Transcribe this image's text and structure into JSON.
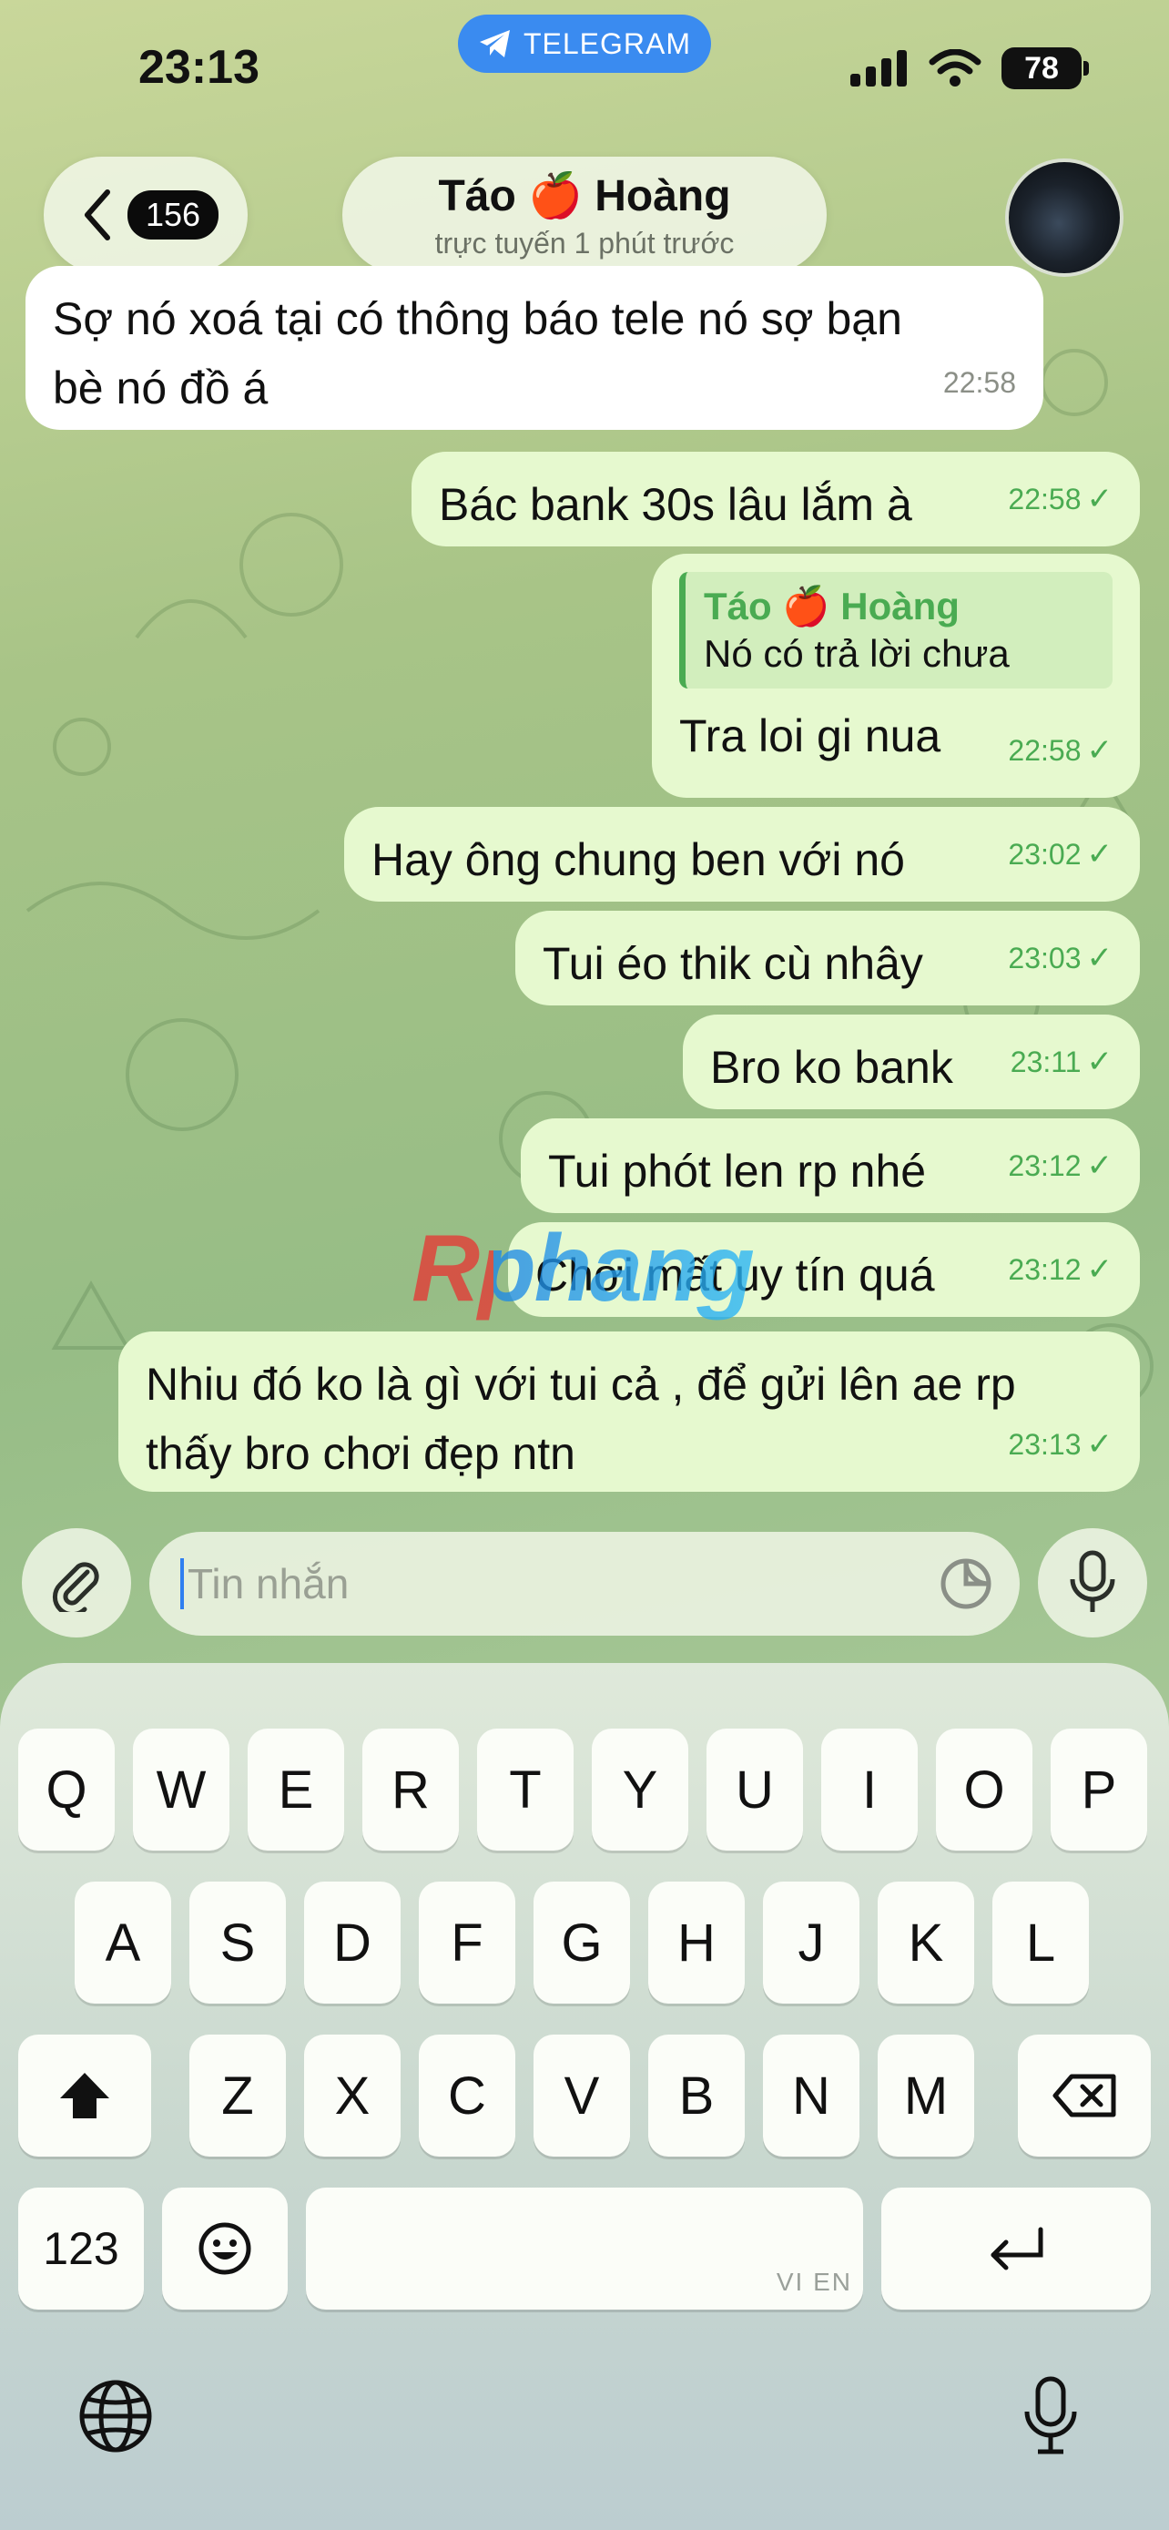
{
  "status_bar": {
    "time": "23:13",
    "app_pill": "TELEGRAM",
    "battery": "78"
  },
  "header": {
    "back_count": "156",
    "contact_name": "Táo 🍎 Hoàng",
    "contact_status": "trực tuyến 1 phút trước"
  },
  "messages": [
    {
      "direction": "in",
      "text_lines": [
        "Sợ nó xoá tại có thông báo tele nó sợ bạn",
        "bè nó đồ á"
      ],
      "time": "22:58"
    },
    {
      "direction": "out",
      "text": "Bác bank 30s lâu lắm à",
      "time": "22:58",
      "check": "✓"
    },
    {
      "direction": "out",
      "reply_name": "Táo 🍎 Hoàng",
      "reply_text": "Nó có trả lời chưa",
      "text": "Tra loi gi nua",
      "time": "22:58",
      "check": "✓"
    },
    {
      "direction": "out",
      "text": "Hay ông chung ben với nó",
      "time": "23:02",
      "check": "✓"
    },
    {
      "direction": "out",
      "text": "Tui éo thik cù nhây",
      "time": "23:03",
      "check": "✓"
    },
    {
      "direction": "out",
      "text": "Bro ko bank",
      "time": "23:11",
      "check": "✓"
    },
    {
      "direction": "out",
      "text": "Tui phót len rp nhé",
      "time": "23:12",
      "check": "✓"
    },
    {
      "direction": "out",
      "text": "Chơi mất uy tín quá",
      "time": "23:12",
      "check": "✓"
    },
    {
      "direction": "out",
      "text_lines": [
        "Nhiu đó ko là gì với tui cả , để gửi lên ae rp",
        "thấy bro chơi đẹp ntn"
      ],
      "time": "23:13",
      "check": "✓"
    }
  ],
  "watermark": "Rphang",
  "composer": {
    "placeholder": "Tin nhắn"
  },
  "keyboard": {
    "row1": [
      "Q",
      "W",
      "E",
      "R",
      "T",
      "Y",
      "U",
      "I",
      "O",
      "P"
    ],
    "row2": [
      "A",
      "S",
      "D",
      "F",
      "G",
      "H",
      "J",
      "K",
      "L"
    ],
    "row3": [
      "Z",
      "X",
      "C",
      "V",
      "B",
      "N",
      "M"
    ],
    "numbers_key": "123",
    "space_hint": "VI EN"
  },
  "icons": {
    "send_plane": "telegram-plane-icon",
    "back": "chevron-left-icon",
    "attach": "paperclip-icon",
    "mic": "microphone-icon",
    "sticker": "sticker-icon",
    "shift": "shift-icon",
    "delete": "backspace-icon",
    "emoji": "emoji-icon",
    "return": "return-icon",
    "globe": "globe-icon",
    "dictation": "dictation-mic-icon"
  },
  "colors": {
    "outgoing_bubble": "#e6f9cf",
    "incoming_bubble": "#ffffff",
    "accent_green": "#4aab52",
    "telegram_blue": "#3a8bf0"
  }
}
